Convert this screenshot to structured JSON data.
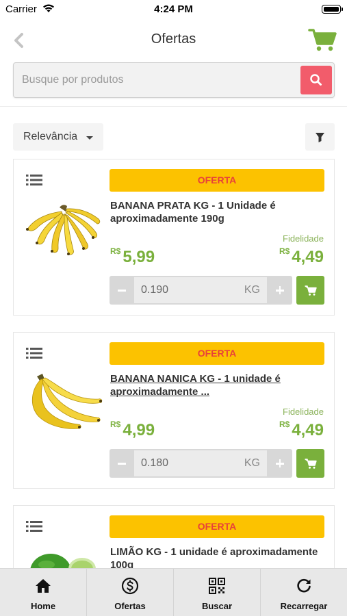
{
  "status_bar": {
    "carrier": "Carrier",
    "time": "4:24 PM"
  },
  "header": {
    "title": "Ofertas"
  },
  "search": {
    "placeholder": "Busque por produtos",
    "value": ""
  },
  "sort": {
    "label": "Relevância"
  },
  "colors": {
    "accent_green": "#7ab03c",
    "offer_badge_bg": "#fcc200",
    "offer_badge_text": "#e8403a",
    "search_button": "#f25c6b"
  },
  "products": [
    {
      "badge": "OFERTA",
      "name": "BANANA PRATA KG - 1 Unidade é aproximadamente 190g",
      "loyalty_label": "Fidelidade",
      "currency": "R$",
      "price": "5,99",
      "loyalty_price": "4,49",
      "quantity": "0.190",
      "unit": "KG"
    },
    {
      "badge": "OFERTA",
      "name": "BANANA NANICA KG - 1 unidade é aproximadamente ...",
      "loyalty_label": "Fidelidade",
      "currency": "R$",
      "price": "4,99",
      "loyalty_price": "4,49",
      "quantity": "0.180",
      "unit": "KG"
    },
    {
      "badge": "OFERTA",
      "name": "LIMÃO KG - 1 unidade é aproximadamente 100g"
    }
  ],
  "tabs": [
    {
      "label": "Home",
      "icon": "home-icon"
    },
    {
      "label": "Ofertas",
      "icon": "dollar-icon"
    },
    {
      "label": "Buscar",
      "icon": "qr-code-icon"
    },
    {
      "label": "Recarregar",
      "icon": "refresh-icon"
    }
  ]
}
